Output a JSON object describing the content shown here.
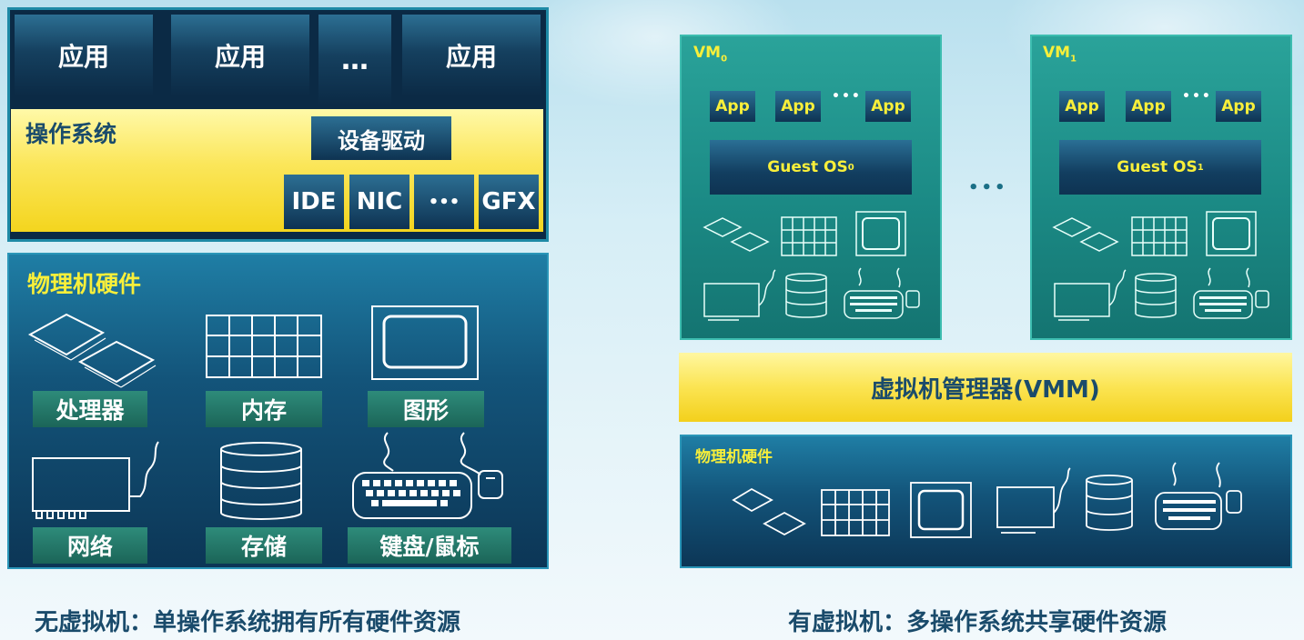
{
  "left": {
    "apps": [
      "应用",
      "应用",
      "…",
      "应用"
    ],
    "os_label": "操作系统",
    "driver_label": "设备驱动",
    "devices": [
      "IDE",
      "NIC",
      "•••",
      "GFX"
    ],
    "hw_title": "物理机硬件",
    "hw_items": [
      "处理器",
      "内存",
      "图形",
      "网络",
      "存储",
      "键盘/鼠标"
    ]
  },
  "right": {
    "vm0_title": "VM",
    "vm0_sub": "0",
    "vm1_title": "VM",
    "vm1_sub": "1",
    "app_label": "App",
    "app_dots": "•••",
    "guest_os": "Guest OS",
    "guest0_sub": "0",
    "guest1_sub": "1",
    "between_dots": "•••",
    "vmm_label": "虚拟机管理器(VMM)",
    "hw_title": "物理机硬件"
  },
  "captions": {
    "left": "无虚拟机：单操作系统拥有所有硬件资源",
    "right": "有虚拟机：多操作系统共享硬件资源"
  },
  "colors": {
    "dark_blue": "#0b2a45",
    "yellow": "#f8ef3a",
    "teal": "#2aa39a",
    "label_green": "#2e8b7a",
    "caption": "#1a4b6b"
  }
}
